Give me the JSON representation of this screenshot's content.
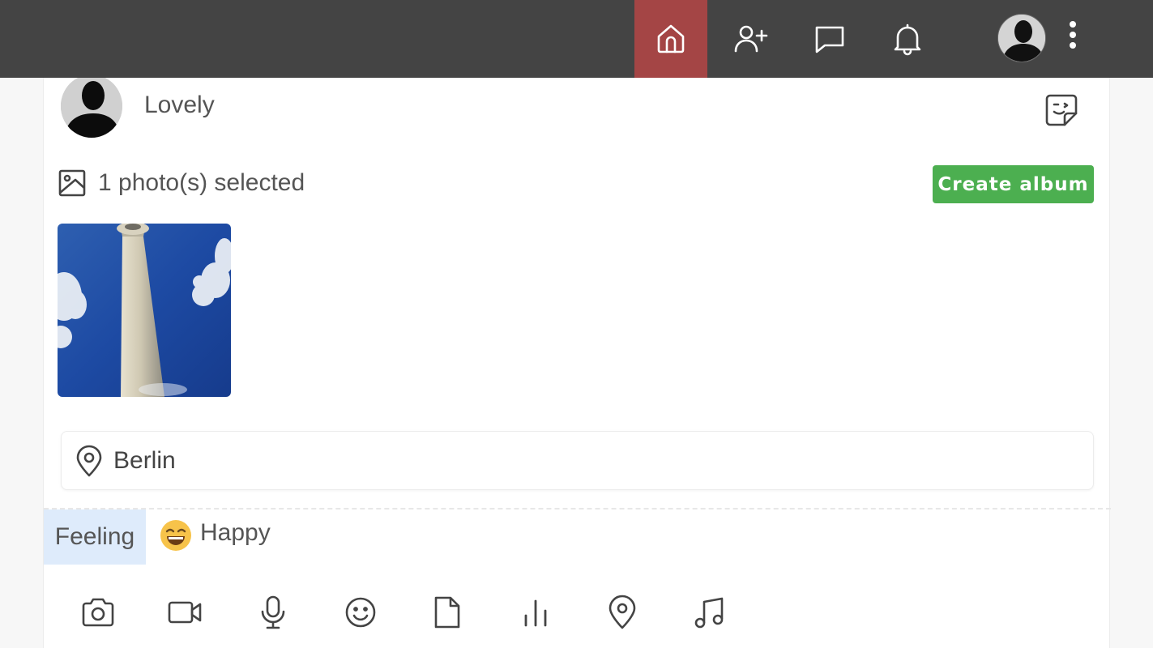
{
  "nav": {
    "items": [
      {
        "icon": "home-icon",
        "active": true
      },
      {
        "icon": "add-friend-icon",
        "active": false
      },
      {
        "icon": "chat-icon",
        "active": false
      },
      {
        "icon": "bell-icon",
        "active": false
      }
    ],
    "active_color": "#a44545",
    "bar_color": "#444444"
  },
  "post": {
    "text": "Lovely"
  },
  "photos": {
    "selected_text": "1 photo(s) selected",
    "create_album_label": "Create album",
    "button_color": "#4caf50"
  },
  "location": {
    "value": "Berlin"
  },
  "feeling": {
    "label": "Feeling",
    "value": "Happy",
    "emoji": "grinning-face"
  },
  "toolbar": {
    "icons": [
      "camera-icon",
      "video-icon",
      "microphone-icon",
      "smiley-icon",
      "file-icon",
      "poll-icon",
      "location-pin-icon",
      "music-note-icon"
    ]
  }
}
